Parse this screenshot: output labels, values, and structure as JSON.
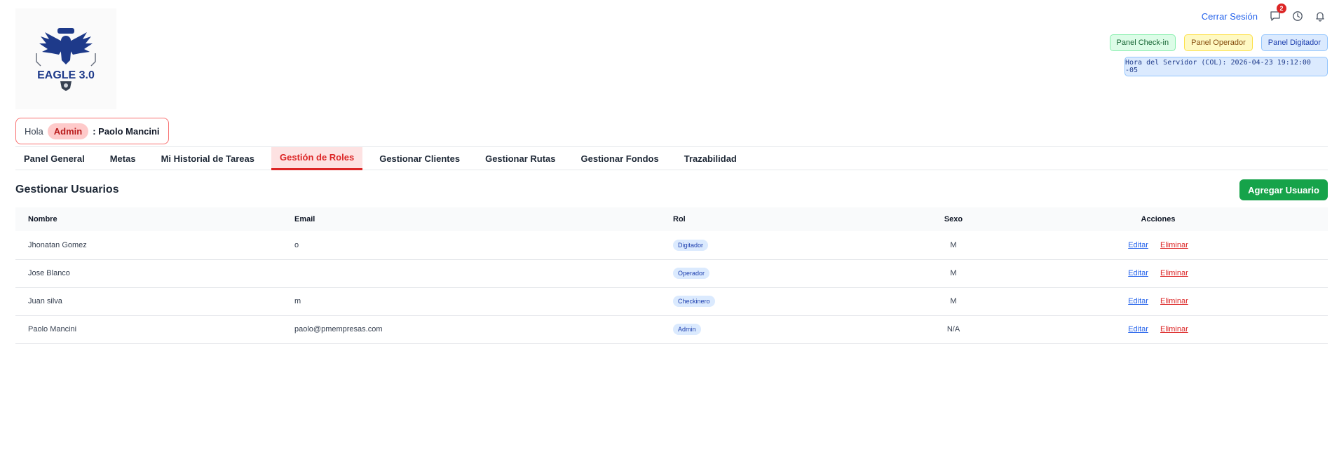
{
  "brand": {
    "logo_text": "EAGLE 3.0"
  },
  "header": {
    "logout_label": "Cerrar Sesión",
    "messages_count": "2",
    "panels": [
      {
        "label": "Panel Check-in"
      },
      {
        "label": "Panel Operador"
      },
      {
        "label": "Panel Digitador"
      }
    ],
    "server_time": "Hora del Servidor (COL): 2026-04-23 19:12:00 -05"
  },
  "greeting": {
    "hola": "Hola",
    "role": "Admin",
    "name": ": Paolo Mancini"
  },
  "tabs": [
    {
      "label": "Panel General"
    },
    {
      "label": "Metas"
    },
    {
      "label": "Mi Historial de Tareas"
    },
    {
      "label": "Gestión de Roles"
    },
    {
      "label": "Gestionar Clientes"
    },
    {
      "label": "Gestionar Rutas"
    },
    {
      "label": "Gestionar Fondos"
    },
    {
      "label": "Trazabilidad"
    }
  ],
  "section": {
    "title": "Gestionar Usuarios",
    "add_label": "Agregar Usuario"
  },
  "table": {
    "headers": {
      "nombre": "Nombre",
      "email": "Email",
      "rol": "Rol",
      "sexo": "Sexo",
      "acciones": "Acciones"
    },
    "rows": [
      {
        "nombre": "Jhonatan Gomez",
        "email": "o",
        "rol": "Digitador",
        "sexo": "M",
        "edit": "Editar",
        "delete": "Eliminar"
      },
      {
        "nombre": "Jose Blanco",
        "email": "",
        "rol": "Operador",
        "sexo": "M",
        "edit": "Editar",
        "delete": "Eliminar"
      },
      {
        "nombre": "Juan silva",
        "email": "m",
        "rol": "Checkinero",
        "sexo": "M",
        "edit": "Editar",
        "delete": "Eliminar"
      },
      {
        "nombre": "Paolo Mancini",
        "email": "paolo@pmempresas.com",
        "rol": "Admin",
        "sexo": "N/A",
        "edit": "Editar",
        "delete": "Eliminar"
      }
    ]
  }
}
